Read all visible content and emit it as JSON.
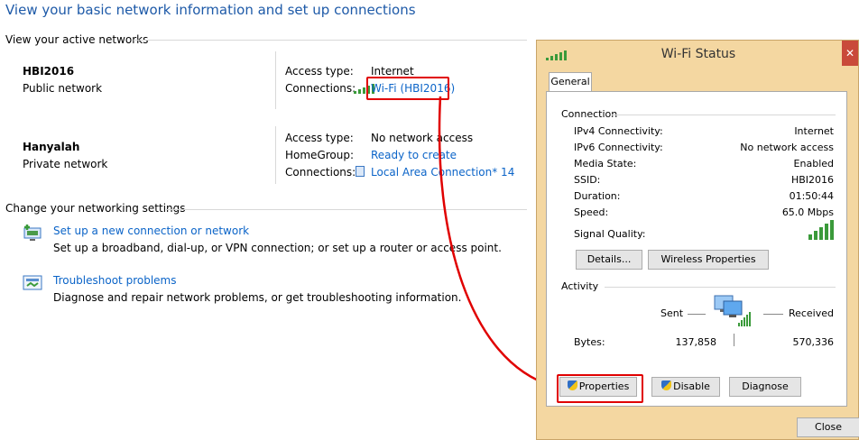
{
  "header": {
    "title": "View your basic network information and set up connections"
  },
  "active_networks": {
    "heading": "View your active networks",
    "networks": [
      {
        "name": "HBI2016",
        "type": "Public network",
        "access_type_label": "Access type:",
        "access_type_value": "Internet",
        "connections_label": "Connections:",
        "connections_value": "Wi-Fi (HBI2016)"
      },
      {
        "name": "Hanyalah",
        "type": "Private network",
        "access_type_label": "Access type:",
        "access_type_value": "No network access",
        "homegroup_label": "HomeGroup:",
        "homegroup_value": "Ready to create",
        "connections_label": "Connections:",
        "connections_value": "Local Area Connection* 14"
      }
    ]
  },
  "settings": {
    "heading": "Change your networking settings",
    "items": [
      {
        "link": "Set up a new connection or network",
        "desc": "Set up a broadband, dial-up, or VPN connection; or set up a router or access point."
      },
      {
        "link": "Troubleshoot problems",
        "desc": "Diagnose and repair network problems, or get troubleshooting information."
      }
    ]
  },
  "dialog": {
    "title": "Wi-Fi Status",
    "close_glyph": "✕",
    "tab": "General",
    "connection": {
      "heading": "Connection",
      "rows": [
        {
          "label": "IPv4 Connectivity:",
          "value": "Internet"
        },
        {
          "label": "IPv6 Connectivity:",
          "value": "No network access"
        },
        {
          "label": "Media State:",
          "value": "Enabled"
        },
        {
          "label": "SSID:",
          "value": "HBI2016"
        },
        {
          "label": "Duration:",
          "value": "01:50:44"
        },
        {
          "label": "Speed:",
          "value": "65.0 Mbps"
        }
      ],
      "signal_label": "Signal Quality:",
      "details_button": "Details...",
      "wireless_button": "Wireless Properties"
    },
    "activity": {
      "heading": "Activity",
      "sent_label": "Sent",
      "received_label": "Received",
      "bytes_label": "Bytes:",
      "bytes_sent": "137,858",
      "bytes_received": "570,336"
    },
    "buttons": {
      "properties": "Properties",
      "disable": "Disable",
      "diagnose": "Diagnose",
      "close": "Close"
    }
  },
  "colors": {
    "link": "#0b64c8",
    "title": "#1e5aa8",
    "annotation": "#e00000",
    "dialog_frame": "#f4d7a1"
  }
}
